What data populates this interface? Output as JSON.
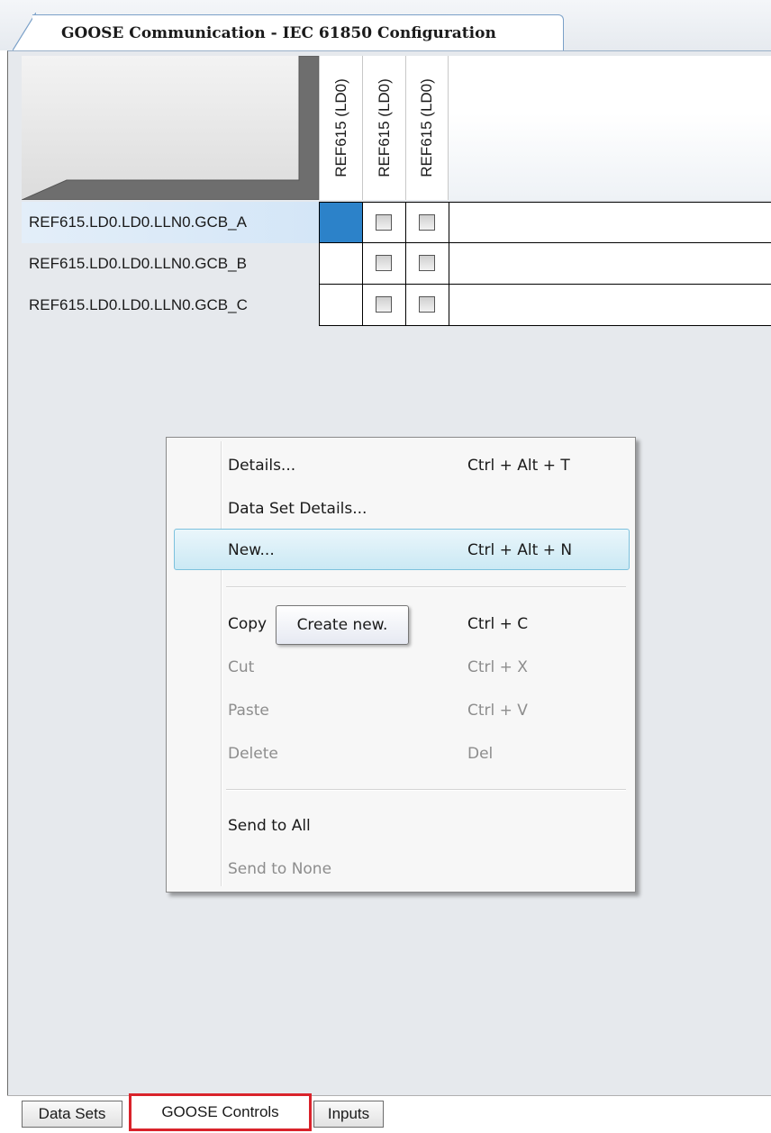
{
  "document_tab": {
    "title": "GOOSE Communication - IEC 61850 Configuration"
  },
  "grid": {
    "columns": [
      "REF615 (LD0)",
      "REF615 (LD0)",
      "REF615 (LD0)"
    ],
    "rows": [
      {
        "label": "REF615.LD0.LD0.LLN0.GCB_A",
        "selected": true
      },
      {
        "label": "REF615.LD0.LD0.LLN0.GCB_B",
        "selected": false
      },
      {
        "label": "REF615.LD0.LD0.LLN0.GCB_C",
        "selected": false
      }
    ]
  },
  "context_menu": {
    "items": [
      {
        "label": "Details...",
        "shortcut": "Ctrl + Alt + T",
        "enabled": true
      },
      {
        "label": "Data Set Details...",
        "shortcut": "",
        "enabled": true
      },
      {
        "label": "New...",
        "shortcut": "Ctrl + Alt + N",
        "enabled": true,
        "highlighted": true
      },
      {
        "label": "Copy",
        "shortcut": "Ctrl + C",
        "enabled": true
      },
      {
        "label": "Cut",
        "shortcut": "Ctrl + X",
        "enabled": false
      },
      {
        "label": "Paste",
        "shortcut": "Ctrl + V",
        "enabled": false
      },
      {
        "label": "Delete",
        "shortcut": "Del",
        "enabled": false
      },
      {
        "label": "Send to All",
        "shortcut": "",
        "enabled": true
      },
      {
        "label": "Send to None",
        "shortcut": "",
        "enabled": false
      }
    ]
  },
  "tooltip": {
    "text": "Create new."
  },
  "bottom_tabs": [
    {
      "label": "Data Sets",
      "active": false
    },
    {
      "label": "GOOSE Controls",
      "active": true
    },
    {
      "label": "Inputs",
      "active": false
    }
  ],
  "colors": {
    "selection": "#2c82c9",
    "menu_highlight": "#cbe9f4",
    "active_tab_outline": "#d9232b"
  }
}
